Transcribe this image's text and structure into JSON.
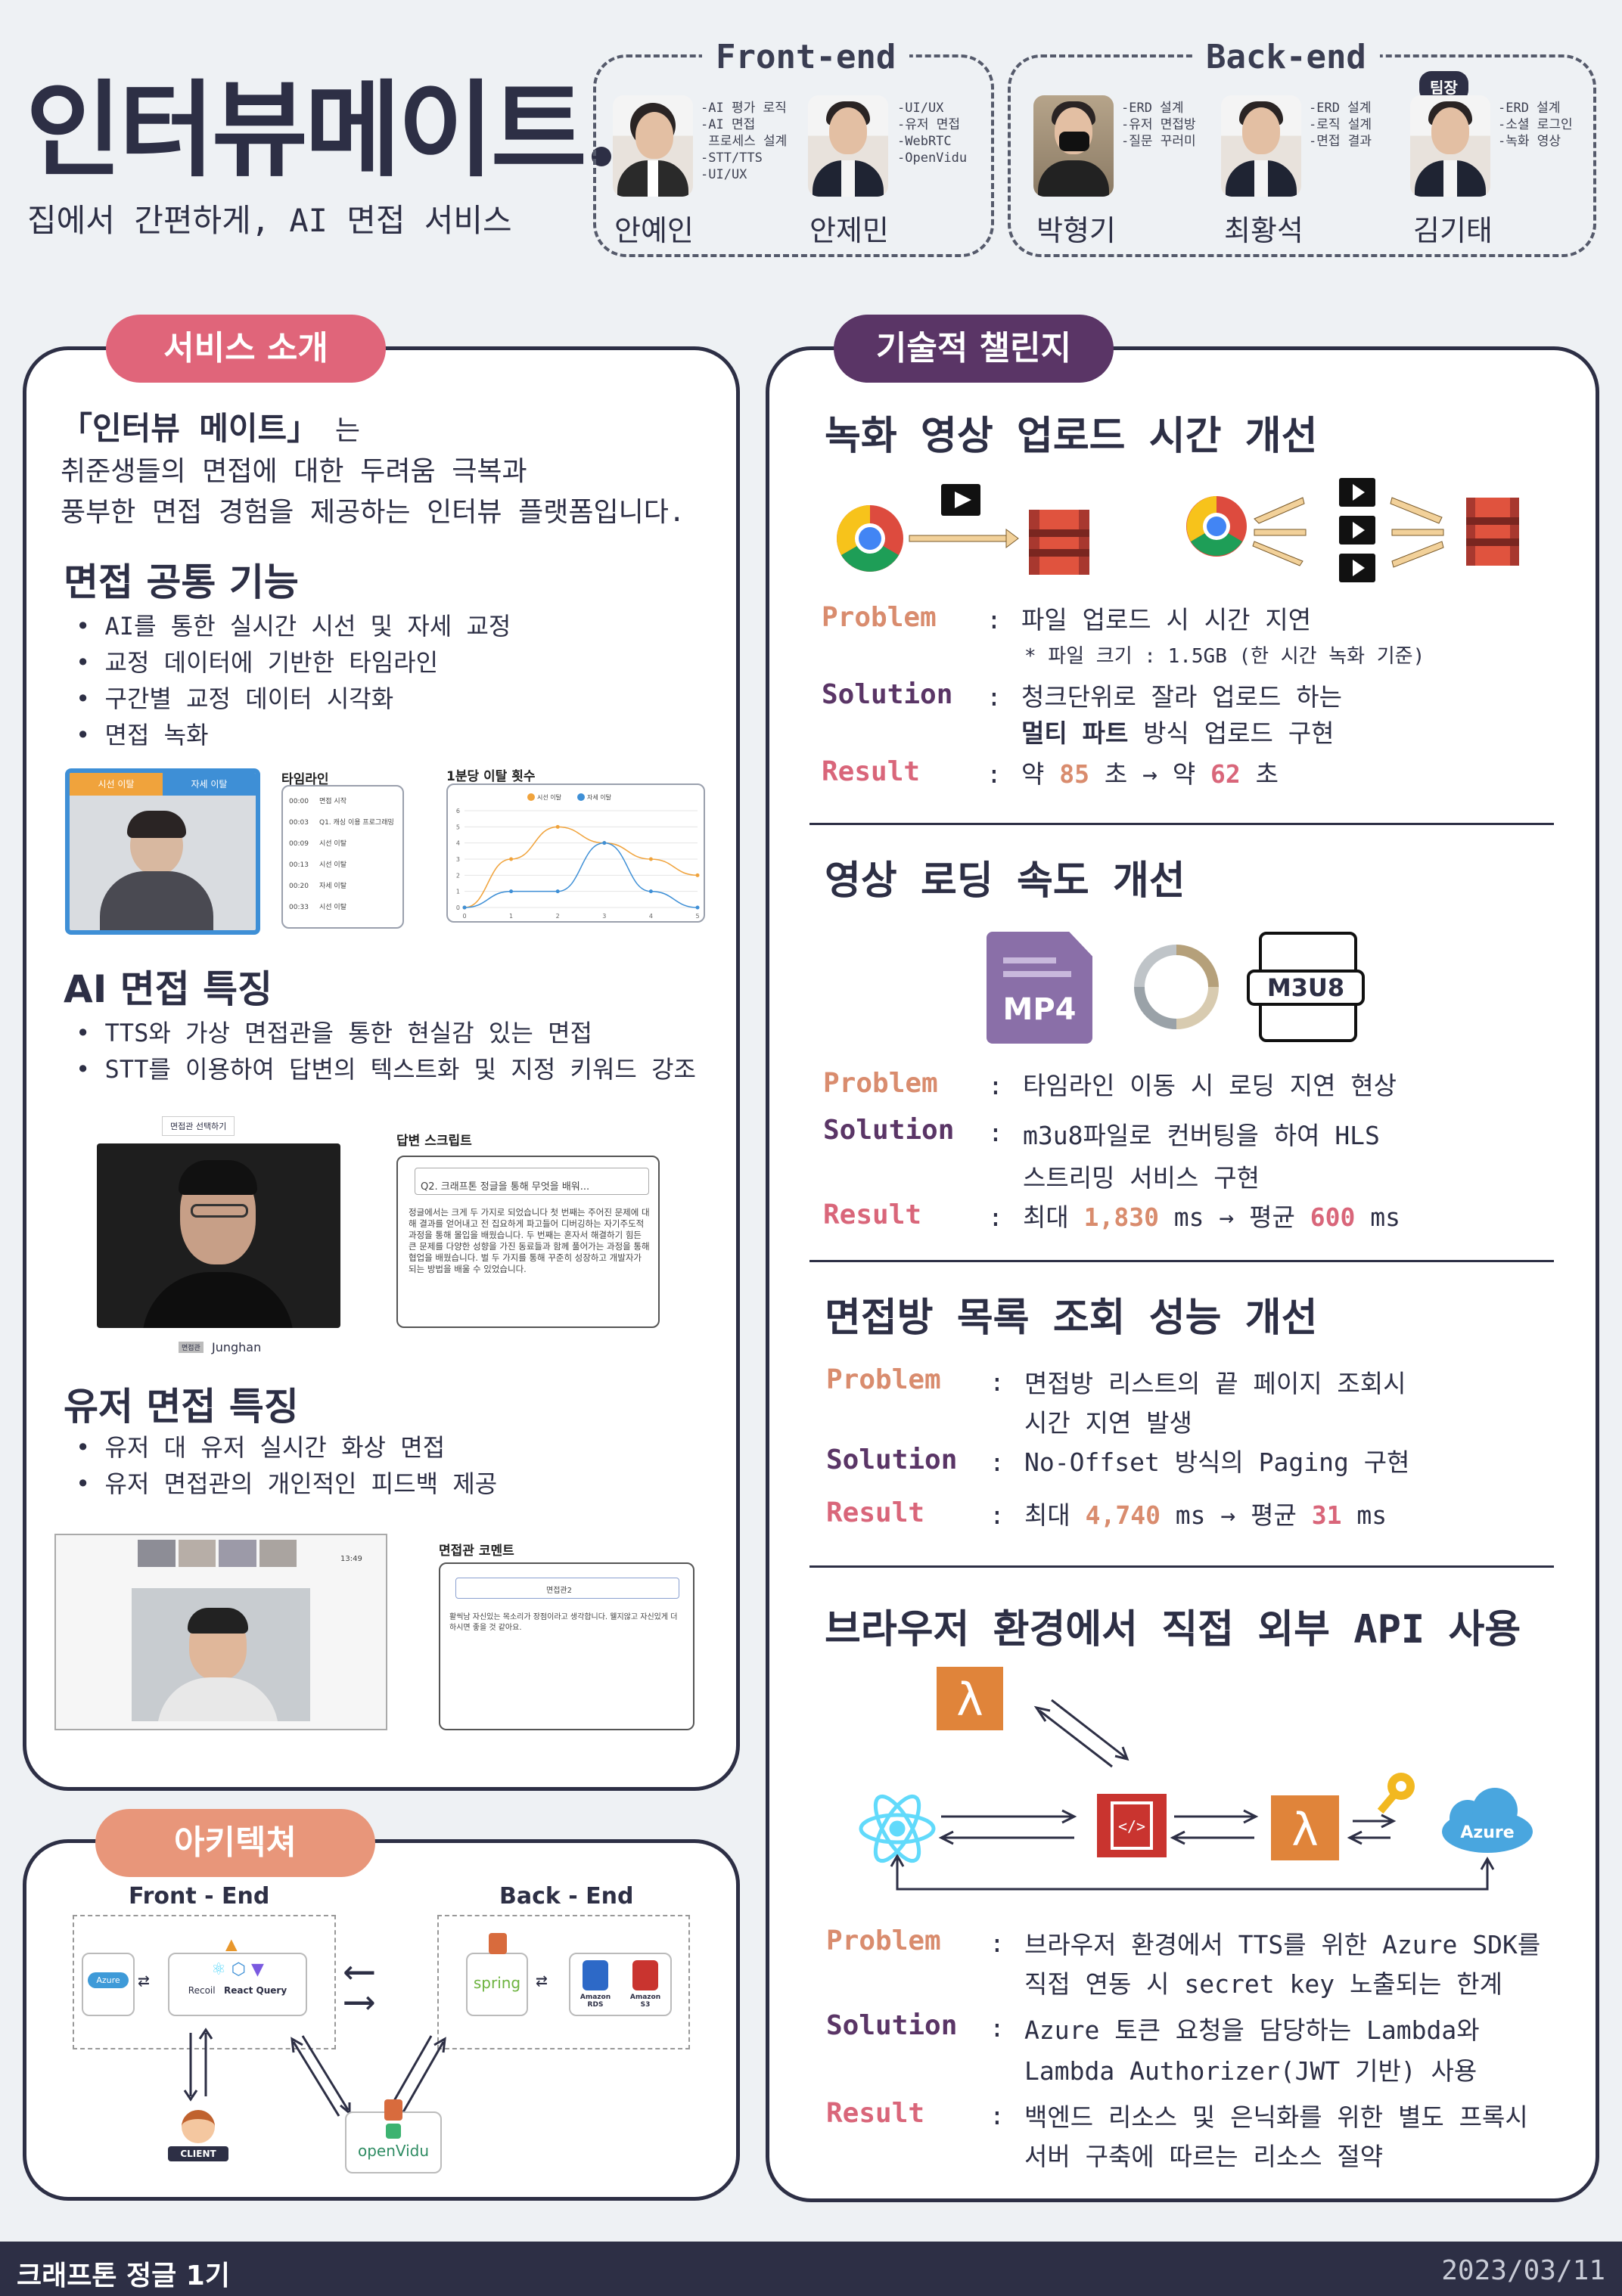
{
  "header": {
    "title": "인터뷰메이트",
    "subtitle": "집에서 간편하게, AI 면접 서비스"
  },
  "team": {
    "frontend_title": "Front-end",
    "backend_title": "Back-end",
    "leader_badge": "팀장",
    "members": [
      {
        "name": "안예인",
        "roles": "-AI 평가 로직\n-AI 면접\n 프로세스 설계\n-STT/TTS\n-UI/UX"
      },
      {
        "name": "안제민",
        "roles": "-UI/UX\n-유저 면접\n-WebRTC\n-OpenVidu"
      },
      {
        "name": "박형기",
        "roles": "-ERD 설계\n-유저 면접방\n-질문 꾸러미"
      },
      {
        "name": "최황석",
        "roles": "-ERD 설계\n-로직 설계\n-면접 결과"
      },
      {
        "name": "김기태",
        "roles": "-ERD 설계\n-소셜 로그인\n-녹화 영상"
      }
    ]
  },
  "service": {
    "pill": "서비스 소개",
    "intro_line1_bold": "「인터뷰 메이트」",
    "intro_line1_rest": "는",
    "intro_line2": "취준생들의 면접에 대한 두려움 극복과",
    "intro_line3": "풍부한 면접 경험을 제공하는 인터뷰 플랫폼입니다.",
    "common_title": "면접 공통 기능",
    "common_items": [
      "AI를 통한 실시간 시선 및 자세 교정",
      "교정 데이터에 기반한 타임라인",
      "구간별 교정 데이터 시각화",
      "면접 녹화"
    ],
    "ai_title": "AI 면접 특징",
    "ai_items": [
      "TTS와 가상 면접관을 통한 현실감 있는 면접",
      "STT를 이용하여 답변의 텍스트화 및 지정 키워드 강조"
    ],
    "user_title": "유저 면접 특징",
    "user_items": [
      "유저 대 유저 실시간 화상 면접",
      "유저 면접관의 개인적인 피드백 제공"
    ],
    "screens": {
      "tab_gaze": "시선 이탈",
      "tab_pose": "자세 이탈",
      "timeline_caption": "타임라인",
      "timeline_rows": [
        {
          "t": "00:00",
          "label": "면접 시작"
        },
        {
          "t": "00:03",
          "label": "Q1. 캐싱 이용 프로그래밍"
        },
        {
          "t": "00:09",
          "label": "시선 이탈"
        },
        {
          "t": "00:13",
          "label": "시선 이탈"
        },
        {
          "t": "00:20",
          "label": "자세 이탈"
        },
        {
          "t": "00:33",
          "label": "시선 이탈"
        }
      ],
      "chart_caption": "1분당 이탈 횟수",
      "choose_interviewer": "면접관 선택하기",
      "interviewer_name": "Junghan",
      "interviewer_tag": "면접관",
      "script_caption": "답변 스크립트",
      "script_question": "Q2. 크래프톤 정글을 통해 무엇을 배워...",
      "script_body": "정글에서는 크게 두 가지로 되었습니다 첫 번째는 주어진 문제에 대해 결과를 얻어내고 전 집요하게 파고들어 디버깅하는 자기주도적 과정을 통해 몰입을 배웠습니다. 두 번째는 혼자서 해결하기 힘든 큰 문제를 다양한 성향을 가진 동료들과 함께 풀어가는 과정을 통해 협업을 배웠습니다. 벌 두 가지를 통해 꾸준히 성장하고 개발자가 되는 방법을 배울 수 있었습니다.",
      "comment_caption": "면접관 코멘트",
      "comment_select": "면접관2",
      "comment_body": "활씩남 자신있는 목소리가 장점이라고 생각합니다. 웰지않고 자신있게 더 하시면 좋을 것 같아요.",
      "video_time": "13:49"
    }
  },
  "chart_data": {
    "type": "line",
    "title": "1분당 이탈 횟수",
    "x": [
      0,
      1,
      2,
      3,
      4,
      5
    ],
    "series": [
      {
        "name": "시선 이탈",
        "values": [
          0,
          3,
          5,
          4,
          3,
          2
        ]
      },
      {
        "name": "자세 이탈",
        "values": [
          0,
          1,
          1,
          4,
          1,
          0
        ]
      }
    ],
    "ylim": [
      0,
      6
    ],
    "legend": "top-center",
    "colors": [
      "#f0a33c",
      "#3e8fd6"
    ]
  },
  "architecture": {
    "pill": "아키텍쳐",
    "frontend": "Front - End",
    "backend": "Back - End",
    "client": "CLIENT",
    "azure": "Azure",
    "recoil": "Recoil",
    "react_query": "React Query",
    "spring": "spring",
    "rds": "Amazon RDS",
    "s3": "Amazon S3",
    "openvidu": "openVidu"
  },
  "challenge": {
    "pill": "기술적 챌린지",
    "labels": {
      "problem": "Problem",
      "solution": "Solution",
      "result": "Result",
      "colon": ":"
    },
    "s1": {
      "title": "녹화 영상 업로드 시간 개선",
      "problem": "파일 업로드 시 시간 지연",
      "problem_note": "* 파일 크기 : 1.5GB (한 시간 녹화 기준)",
      "solution1": "청크단위로 잘라 업로드 하는",
      "solution2_bold": "멀티 파트",
      "solution2_rest": " 방식 업로드 구현",
      "r_pre": "약 ",
      "r_from": "85",
      "r_mid": " 초 → 약 ",
      "r_to": "62",
      "r_post": " 초"
    },
    "s2": {
      "title": "영상 로딩 속도 개선",
      "mp4": "MP4",
      "m3u8": "M3U8",
      "problem": "타임라인 이동 시 로딩 지연 현상",
      "solution1": "m3u8파일로 컨버팅을 하여 HLS",
      "solution2": "스트리밍 서비스 구현",
      "r_pre": "최대 ",
      "r_from": "1,830",
      "r_mid": " ms → 평균 ",
      "r_to": "600",
      "r_post": " ms"
    },
    "s3": {
      "title": "면접방 목록 조회 성능 개선",
      "problem1": "면접방 리스트의 끝 페이지 조회시",
      "problem2": "시간 지연 발생",
      "solution": "No-Offset 방식의 Paging 구현",
      "r_pre": "최대 ",
      "r_from": "4,740",
      "r_mid": " ms → 평균 ",
      "r_to": "31",
      "r_post": " ms"
    },
    "s4": {
      "title": "브라우저 환경에서 직접 외부 API 사용",
      "azure": "Azure",
      "problem1": "브라우저 환경에서 TTS를 위한 Azure SDK를",
      "problem2": "직접 연동 시 secret key 노출되는 한계",
      "solution1": "Azure 토큰 요청을 담당하는 Lambda와",
      "solution2": "Lambda Authorizer(JWT 기반) 사용",
      "result1": "백엔드 리소스 및 은닉화를 위한 별도 프록시",
      "result2": "서버 구축에 따르는 리소스 절약"
    }
  },
  "footer": {
    "left": "크래프톤 정글 1기",
    "right": "2023/03/11"
  },
  "colors": {
    "navy": "#2d2f45",
    "pink_pill": "#e0657a",
    "purple_pill": "#5a3566",
    "orange_pill": "#e8967a",
    "problem": "#d98c6e",
    "solution": "#5a3566",
    "result": "#d9667a"
  }
}
